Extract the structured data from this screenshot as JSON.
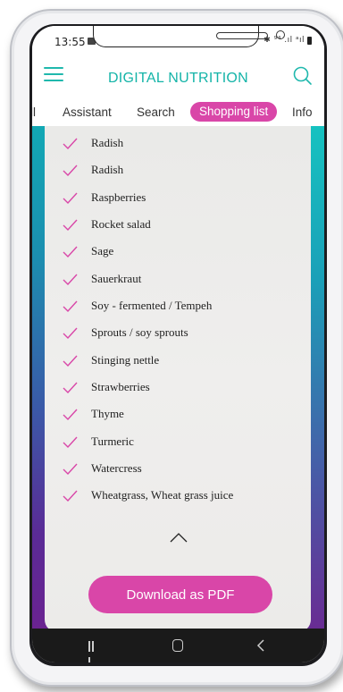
{
  "status_bar": {
    "time": "13:55",
    "icons": "✱ ⁹⁴ .ıl ᵃıl"
  },
  "header": {
    "title": "DIGITAL NUTRITION"
  },
  "tabs": [
    {
      "label": "ll"
    },
    {
      "label": "Assistant"
    },
    {
      "label": "Search"
    },
    {
      "label": "Shopping list",
      "active": true
    },
    {
      "label": "Info"
    }
  ],
  "shopping_list": {
    "items": [
      "Radish",
      "Radish",
      "Raspberries",
      "Rocket salad",
      "Sage",
      "Sauerkraut",
      "Soy - fermented / Tempeh",
      "Sprouts / soy sprouts",
      "Stinging nettle",
      "Strawberries",
      "Thyme",
      "Turmeric",
      "Watercress",
      "Wheatgrass, Wheat grass juice"
    ],
    "download_label": "Download as PDF"
  },
  "colors": {
    "accent_teal": "#14b4a8",
    "accent_magenta": "#d946a8"
  }
}
